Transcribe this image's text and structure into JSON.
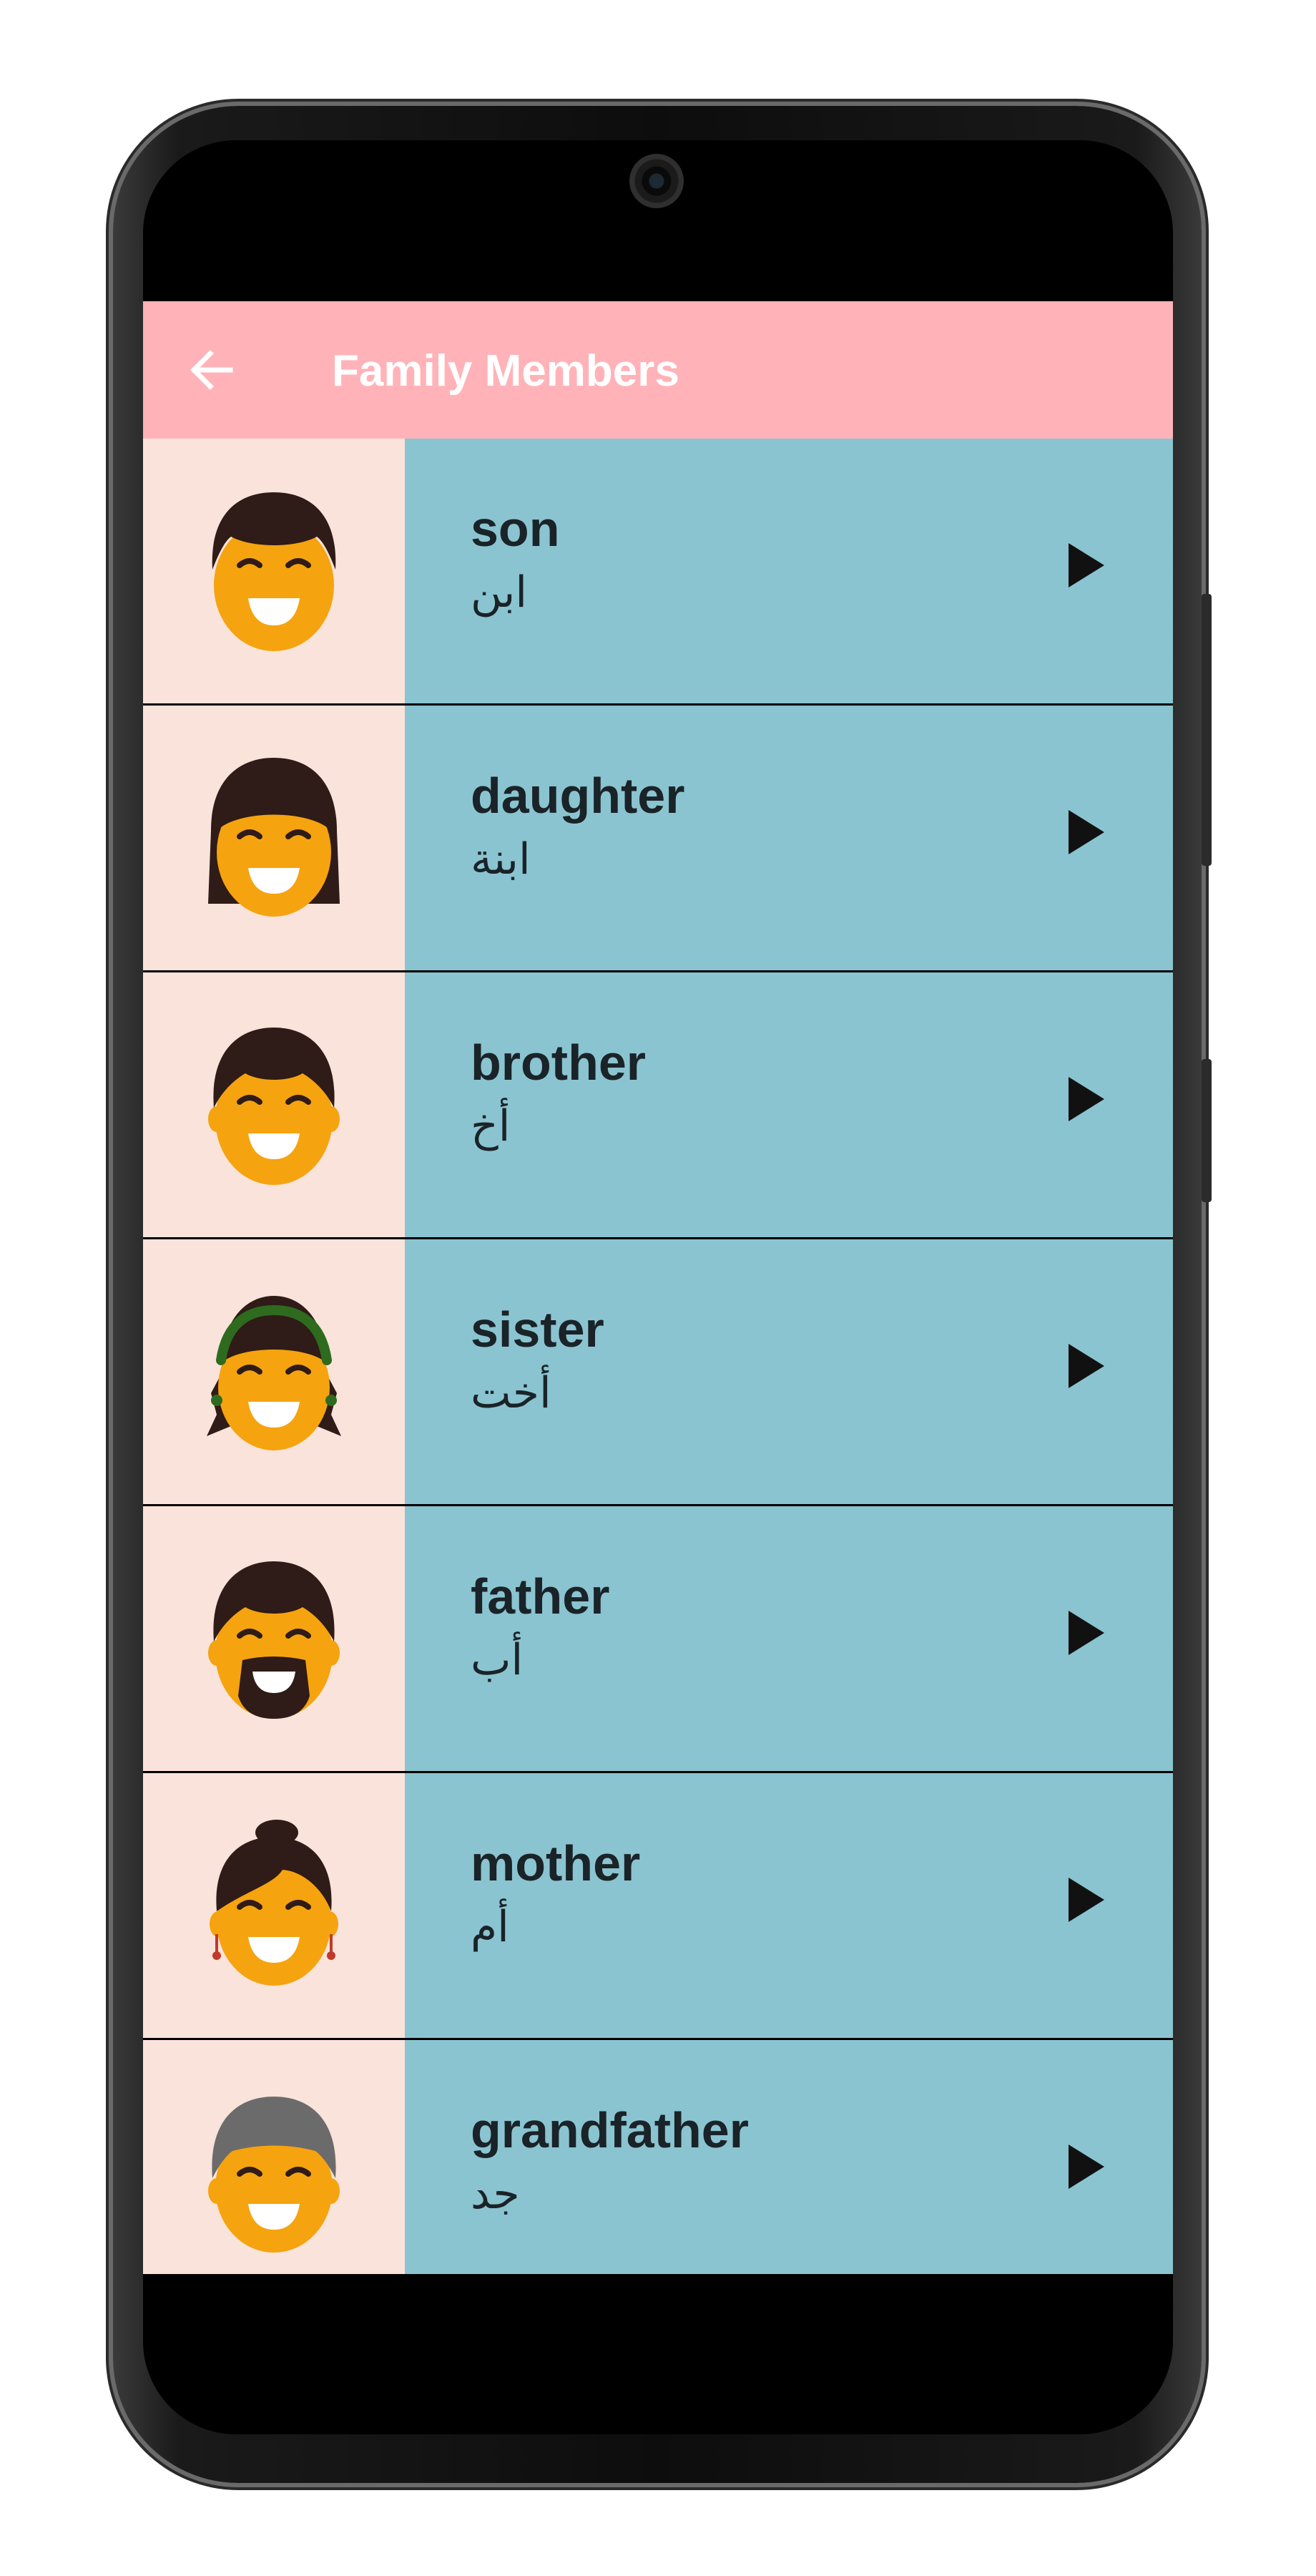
{
  "app": {
    "title": "Family Members",
    "back_icon": "arrow-left-icon",
    "colors": {
      "appbar": "#ffb3b8",
      "avatar_bg": "#f9e3da",
      "row_bg": "#8ac4d0",
      "text": "#1a2328"
    }
  },
  "items": [
    {
      "english": "son",
      "arabic": "ابن",
      "avatar": "son-face-icon",
      "action_icon": "play-icon"
    },
    {
      "english": "daughter",
      "arabic": "ابنة",
      "avatar": "daughter-face-icon",
      "action_icon": "play-icon"
    },
    {
      "english": "brother",
      "arabic": "أخ",
      "avatar": "brother-face-icon",
      "action_icon": "play-icon"
    },
    {
      "english": "sister",
      "arabic": "أخت",
      "avatar": "sister-face-icon",
      "action_icon": "play-icon"
    },
    {
      "english": "father",
      "arabic": "أب",
      "avatar": "father-face-icon",
      "action_icon": "play-icon"
    },
    {
      "english": "mother",
      "arabic": "أم",
      "avatar": "mother-face-icon",
      "action_icon": "play-icon"
    },
    {
      "english": "grandfather",
      "arabic": "جد",
      "avatar": "grandfather-face-icon",
      "action_icon": "play-icon"
    }
  ]
}
